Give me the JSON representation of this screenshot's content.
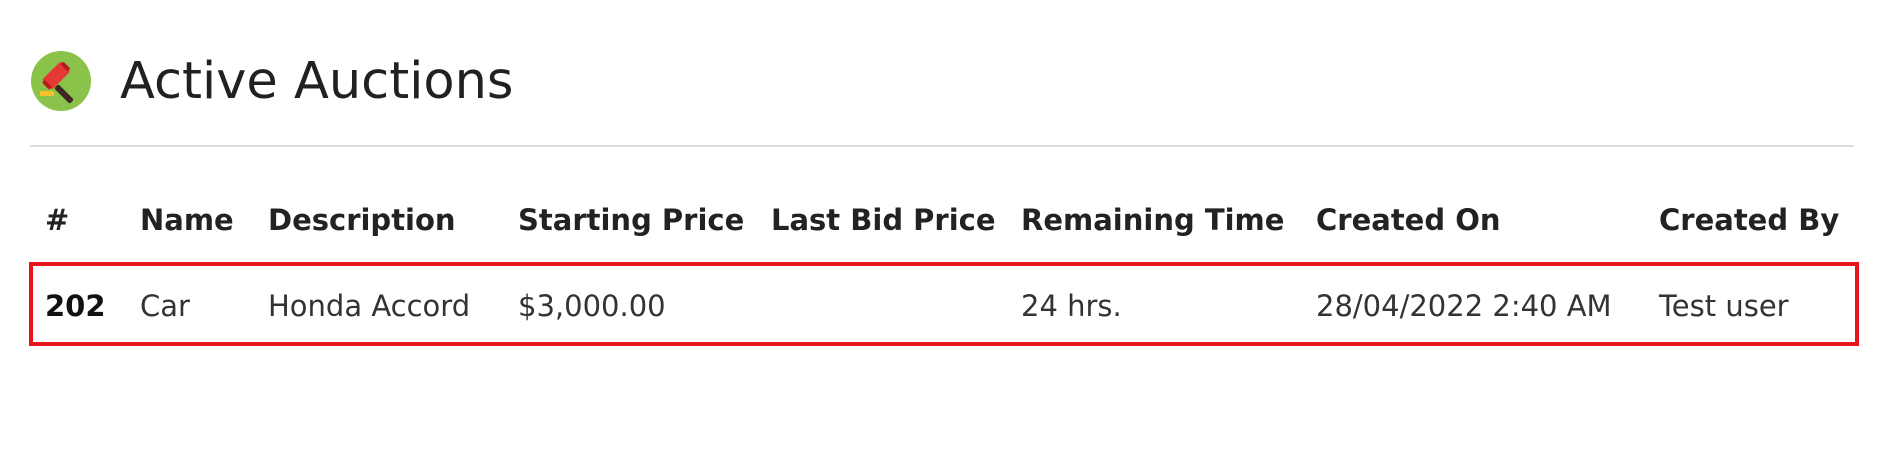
{
  "header": {
    "title": "Active Auctions",
    "icon": "gavel-icon"
  },
  "table": {
    "columns": [
      "#",
      "Name",
      "Description",
      "Starting Price",
      "Last Bid Price",
      "Remaining Time",
      "Created On",
      "Created By"
    ],
    "rows": [
      {
        "id": "202",
        "name": "Car",
        "description": "Honda Accord",
        "starting_price": "$3,000.00",
        "last_bid_price": "",
        "remaining_time": "24 hrs.",
        "created_on": "28/04/2022 2:40 AM",
        "created_by": "Test user"
      }
    ]
  },
  "colors": {
    "highlight": "#e8141b",
    "icon_bg": "#8bc34a",
    "divider": "#dcdcdc"
  }
}
